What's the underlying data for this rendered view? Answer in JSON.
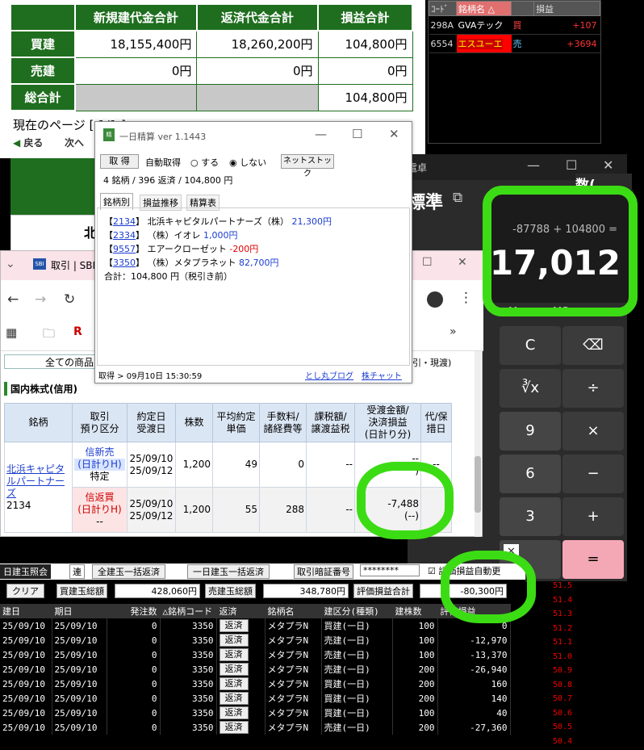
{
  "summary": {
    "headers": [
      "新規建代金合計",
      "返済代金合計",
      "損益合計"
    ],
    "rows": [
      {
        "label": "買建",
        "vals": [
          "18,155,400円",
          "18,260,200円",
          "104,800円"
        ]
      },
      {
        "label": "売建",
        "vals": [
          "0円",
          "0円",
          "0円"
        ]
      },
      {
        "label": "総合計",
        "vals": [
          "",
          "",
          "104,800円"
        ]
      }
    ],
    "current_page": "現在のページ [ 1/1 ]",
    "back": "戻る",
    "next": "次へ"
  },
  "board": {
    "headers": [
      "ｺｰﾄﾞ",
      "銘柄名",
      "",
      "損益"
    ],
    "rows": [
      {
        "code": "298A",
        "name": "GVAテック",
        "side": "買",
        "pnl": "+107"
      },
      {
        "code": "6554",
        "name": "エスユーエ",
        "side": "売",
        "pnl": "+3694"
      }
    ]
  },
  "calc": {
    "title": "電卓",
    "mode": "標準",
    "expr": "-87788 + 104800 =",
    "result": "17,012",
    "mem": [
      "M-",
      "MS"
    ],
    "keys": [
      "C",
      "⌫",
      "∛x",
      "÷",
      "9",
      "×",
      "6",
      "−",
      "3",
      "+",
      "",
      "="
    ],
    "behind": "数("
  },
  "browser": {
    "tab": "取引 | SBI",
    "filter": "全ての商品",
    "filter_right": "引・現渡)",
    "section": "国内株式(信用)",
    "headers": [
      "銘柄",
      "取引\n預り区分",
      "約定日\n受渡日",
      "株数",
      "平均約定\n単価",
      "手数料/\n諸経費等",
      "課税額/\n譲渡益税",
      "受渡金額/\n決済損益\n(日計り分)",
      "代/保\n措日"
    ],
    "stock_name": "北浜キャピタルパートナーズ",
    "stock_code": "2134",
    "row1": {
      "type": "信新売",
      "sub": "(日計りH)",
      "acct": "特定",
      "date1": "25/09/10",
      "date2": "25/09/12",
      "qty": "1,200",
      "price": "49",
      "fee": "0",
      "tax": "--",
      "amt": "--",
      "amt2": ")",
      "last": "--"
    },
    "row2": {
      "type": "信返買",
      "sub": "(日計りH)",
      "acct": "--",
      "date1": "25/09/10",
      "date2": "25/09/12",
      "qty": "1,200",
      "price": "55",
      "fee": "288",
      "tax": "--",
      "amt": "-7,488",
      "amt2": "(--)"
    }
  },
  "seisan": {
    "title": "一日精算 ver 1.1443",
    "get": "取 得",
    "auto": "自動取得",
    "yes": "する",
    "no": "しない",
    "net": "ネットストック",
    "stats": "4 銘柄 / 396 返済 / 104,800 円",
    "tabs": [
      "銘柄別",
      "損益推移",
      "精算表"
    ],
    "items": [
      {
        "code": "2134",
        "name": "北浜キャピタルパートナーズ（株）",
        "pnl": "21,300円",
        "color": "#1a3ccf"
      },
      {
        "code": "2334",
        "name": "（株）イオレ",
        "pnl": "1,000円",
        "color": "#1a3ccf"
      },
      {
        "code": "9557",
        "name": "エアークローゼット",
        "pnl": "-200円",
        "color": "#d00"
      },
      {
        "code": "3350",
        "name": "（株）メタプラネット",
        "pnl": "82,700円",
        "color": "#1a3ccf"
      }
    ],
    "total": "合計：104,800 円（税引き前）",
    "status": "取得 > 09月10日 15:30:59",
    "blog": "とし丸ブログ",
    "chat": "株チャット"
  },
  "trade": {
    "tabs": [
      "日建玉照会",
      "連",
      "全建玉一括返済",
      "一日建玉一括返済",
      "取引暗証番号"
    ],
    "pin": "********",
    "auto": "評価損益自動更",
    "clear": "クリア",
    "buy_label": "買建玉総額",
    "buy_val": "428,060円",
    "sell_label": "売建玉総額",
    "sell_val": "348,780円",
    "eval_label": "評価損益合計",
    "eval_val": "-80,300円",
    "headers": [
      "建日",
      "期日",
      "発注数",
      "△銘柄コード",
      "返済",
      "銘柄名",
      "建区分(種類)",
      "建株数",
      "評価損益"
    ],
    "rows": [
      [
        "25/09/10",
        "25/09/10",
        "0",
        "3350",
        "返済",
        "メタプラN",
        "買建(一日)",
        "100",
        "0"
      ],
      [
        "25/09/10",
        "25/09/10",
        "0",
        "3350",
        "返済",
        "メタプラN",
        "売建(一日)",
        "100",
        "-12,970"
      ],
      [
        "25/09/10",
        "25/09/10",
        "0",
        "3350",
        "返済",
        "メタプラN",
        "売建(一日)",
        "100",
        "-13,370"
      ],
      [
        "25/09/10",
        "25/09/10",
        "0",
        "3350",
        "返済",
        "メタプラN",
        "売建(一日)",
        "200",
        "-26,940"
      ],
      [
        "25/09/10",
        "25/09/10",
        "0",
        "3350",
        "返済",
        "メタプラN",
        "買建(一日)",
        "200",
        "160"
      ],
      [
        "25/09/10",
        "25/09/10",
        "0",
        "3350",
        "返済",
        "メタプラN",
        "買建(一日)",
        "200",
        "140"
      ],
      [
        "25/09/10",
        "25/09/10",
        "0",
        "3350",
        "返済",
        "メタプラN",
        "買建(一日)",
        "100",
        "40"
      ],
      [
        "25/09/10",
        "25/09/10",
        "0",
        "3350",
        "返済",
        "メタプラN",
        "売建(一日)",
        "200",
        "-27,360"
      ]
    ]
  },
  "prices": [
    "51.5",
    "51.4",
    "51.3",
    "51.2",
    "51.1",
    "51.0",
    "50.9",
    "50.8",
    "50.7",
    "50.6",
    "50.5",
    "50.4"
  ]
}
